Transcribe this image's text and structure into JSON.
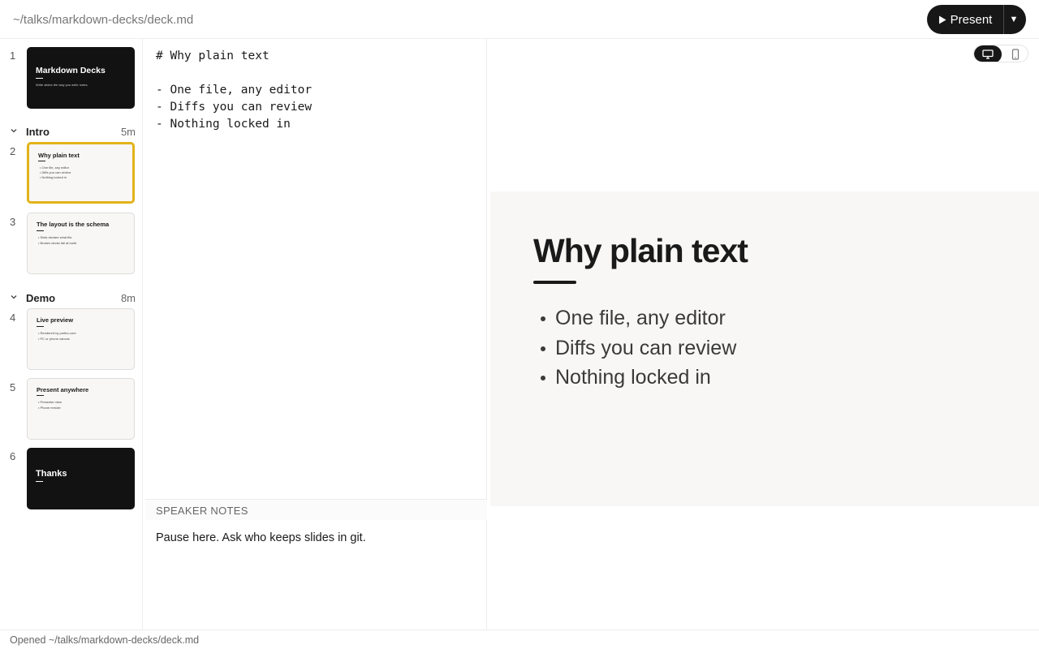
{
  "header": {
    "file_path": "~/talks/markdown-decks/deck.md",
    "present_label": "Present",
    "present_icon": "play-icon",
    "present_caret": "▼"
  },
  "sidebar": {
    "slides": [
      {
        "num": "1",
        "title": "Markdown Decks",
        "subtitle": "Write slides the way you write notes.",
        "theme": "dark",
        "bullets": []
      },
      {
        "num": "2",
        "title": "Why plain text",
        "theme": "light",
        "selected": true,
        "bullets": [
          "One file, any editor",
          "Diffs you can review",
          "Nothing locked in"
        ]
      },
      {
        "num": "3",
        "title": "The layout is the schema",
        "theme": "light",
        "bullets": [
          "Slots declare what fits",
          "Broken decks fail at build"
        ]
      },
      {
        "num": "4",
        "title": "Live preview",
        "theme": "light",
        "bullets": [
          "Rendered by pmtho-core",
          "PC or phone canvas"
        ]
      },
      {
        "num": "5",
        "title": "Present anywhere",
        "theme": "light",
        "bullets": [
          "Presenter view",
          "Phone remote"
        ]
      },
      {
        "num": "6",
        "title": "Thanks",
        "theme": "dark",
        "bullets": []
      }
    ],
    "sections": [
      {
        "name": "Intro",
        "duration": "5m"
      },
      {
        "name": "Demo",
        "duration": "8m"
      }
    ]
  },
  "editor": {
    "source": "# Why plain text\n\n- One file, any editor\n- Diffs you can review\n- Nothing locked in",
    "notes_label": "SPEAKER NOTES",
    "notes_text": "Pause here. Ask who keeps slides in git."
  },
  "preview": {
    "device_toggle": {
      "selected": "desktop",
      "options": [
        "desktop-icon",
        "phone-icon"
      ]
    },
    "slide": {
      "title": "Why plain text",
      "bullets": [
        "One file, any editor",
        "Diffs you can review",
        "Nothing locked in"
      ]
    }
  },
  "status": {
    "text": "Opened ~/talks/markdown-decks/deck.md"
  },
  "colors": {
    "accent_selected": "#e2b219",
    "dark_slide": "#121212",
    "light_slide": "#f8f7f5"
  }
}
